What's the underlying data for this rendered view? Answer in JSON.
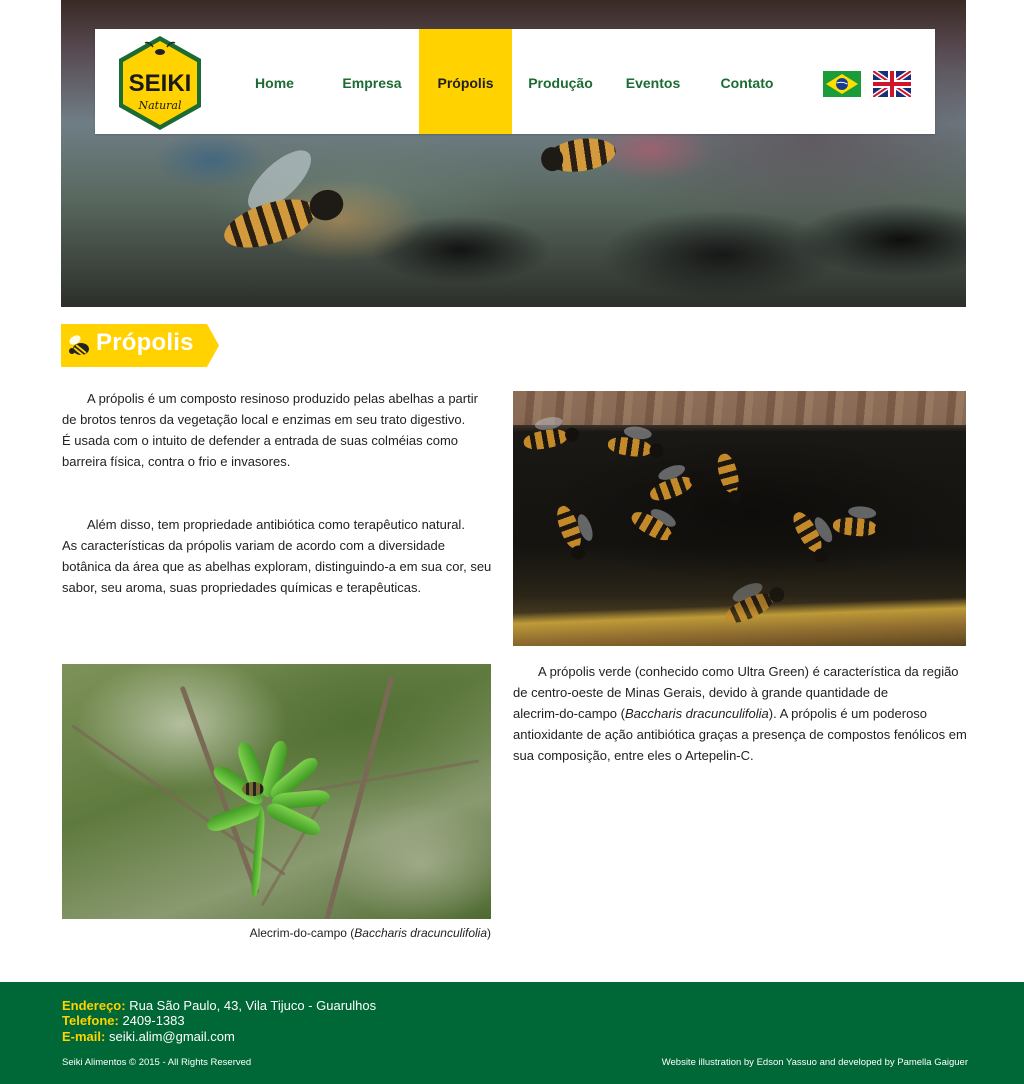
{
  "brand": {
    "logo_text": "SEIKI",
    "logo_subtext": "Natural",
    "colors": {
      "green": "#1b6b32",
      "yellow": "#ffd200",
      "footer": "#006837"
    }
  },
  "nav": {
    "items": [
      {
        "label": "Home",
        "active": false
      },
      {
        "label": "Empresa",
        "active": false
      },
      {
        "label": "Própolis",
        "active": true
      },
      {
        "label": "Produção",
        "active": false
      },
      {
        "label": "Eventos",
        "active": false
      },
      {
        "label": "Contato",
        "active": false
      }
    ],
    "languages": [
      "brazil-flag-icon",
      "uk-flag-icon"
    ]
  },
  "page": {
    "title": "Própolis",
    "paragraph1": {
      "line1": "A própolis é um composto resinoso produzido pelas abelhas a partir",
      "line2": "de brotos tenros da vegetação local e enzimas em seu trato digestivo.",
      "line3": "É usada com o intuito de defender a entrada de suas colméias como",
      "line4": "barreira física, contra o frio e invasores."
    },
    "paragraph2": {
      "line1": "Além disso, tem propriedade antibiótica como terapêutico natural.",
      "line2": "As características da própolis variam de acordo com a diversidade",
      "line3": "botânica da área que as abelhas exploram, distinguindo-a em sua cor, seu",
      "line4": "sabor, seu aroma, suas propriedades químicas e terapêuticas."
    },
    "paragraph3": {
      "line1": "A própolis verde (conhecido como Ultra Green) é característica da região",
      "line2": "de centro-oeste de Minas Gerais, devido à grande quantidade de",
      "line3_pre": "alecrim-do-campo (",
      "line3_em": "Baccharis dracunculifolia",
      "line3_post": "). A própolis é um poderoso",
      "line4": "antioxidante de ação antibiótica graças a presença de compostos fenólicos em",
      "line5": "sua composição, entre eles o Artepelin-C."
    },
    "caption": {
      "pre": "Alecrim-do-campo (",
      "em": "Baccharis dracunculifolia",
      "post": ")"
    }
  },
  "footer": {
    "address_label": "Endereço:",
    "address": "Rua São Paulo, 43, Vila Tijuco - Guarulhos",
    "phone_label": "Telefone:",
    "phone": "2409-1383",
    "email_label": "E-mail:",
    "email": "seiki.alim@gmail.com",
    "copyright": "Seiki Alimentos © 2015 - All Rights Reserved",
    "credits": "Website illustration by Edson Yassuo and developed by Pamella Gaiguer"
  }
}
